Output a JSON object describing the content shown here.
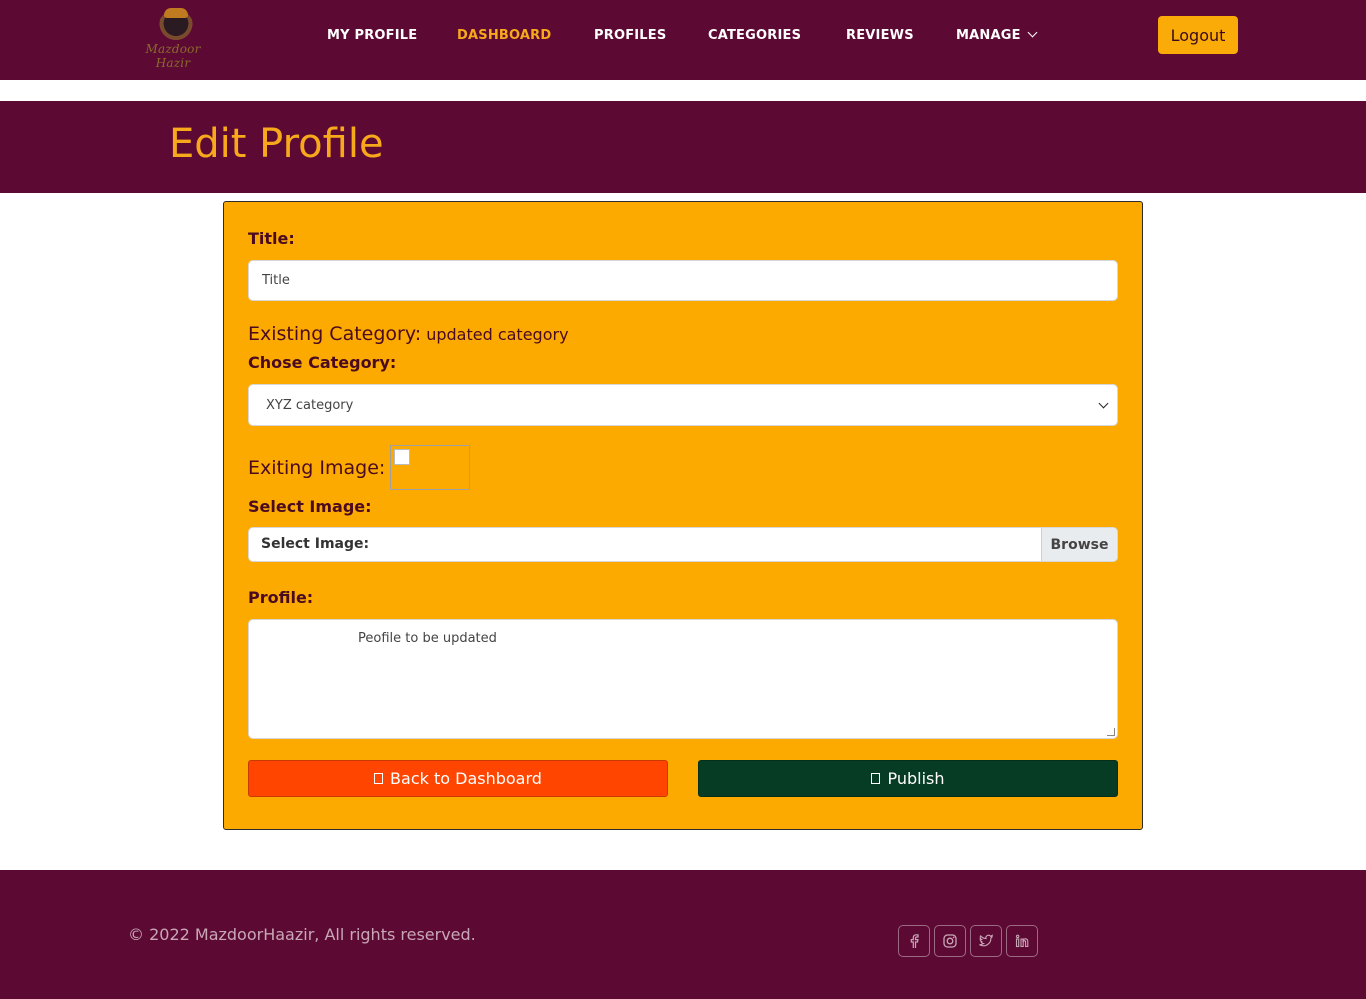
{
  "nav": {
    "logo_text": "Mazdoor Hazir",
    "items": [
      {
        "label": "MY PROFILE"
      },
      {
        "label": "DASHBOARD"
      },
      {
        "label": "PROFILES"
      },
      {
        "label": "CATEGORIES"
      },
      {
        "label": "REVIEWS"
      },
      {
        "label": "MANAGE"
      }
    ],
    "active_item": "DASHBOARD",
    "logout_label": "Logout"
  },
  "header": {
    "title": "Edit Profile"
  },
  "form": {
    "title_label": "Title:",
    "title_placeholder": "Title",
    "existing_category_label": "Existing Category:",
    "existing_category_value": "updated category",
    "choose_category_label": "Chose Category:",
    "category_selected": "XYZ category",
    "existing_image_label": "Exiting Image:",
    "select_image_label": "Select Image:",
    "file_input_label": "Select Image:",
    "browse_label": "Browse",
    "profile_label": "Profile:",
    "profile_text": "Peofile to be updated",
    "back_button": "Back to Dashboard",
    "publish_button": "Publish"
  },
  "footer": {
    "copyright": "© 2022 MazdoorHaazir, All rights reserved.",
    "social_icons": [
      "facebook-icon",
      "instagram-icon",
      "twitter-icon",
      "linkedin-icon"
    ]
  },
  "colors": {
    "brand_maroon": "#5c0a33",
    "accent_orange": "#f7a81b",
    "card_bg": "#fdaa00",
    "back_button": "#ff4500",
    "publish_button": "#063c23"
  }
}
